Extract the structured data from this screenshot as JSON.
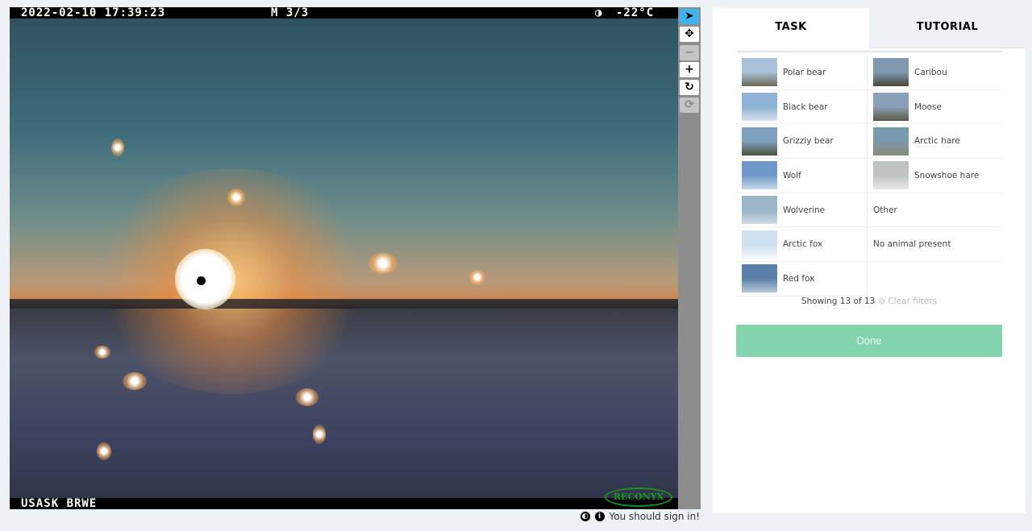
{
  "photo": {
    "timestamp": "2022-02-10 17:39:23",
    "frame": "M 3/3",
    "temperature": "-22°C",
    "moon_icon": "half-moon-icon",
    "camera_id": "USASK BRWE",
    "brand_logo": "RECONYX"
  },
  "toolbar": [
    {
      "name": "pointer",
      "glyph": "➤",
      "state": "active"
    },
    {
      "name": "move",
      "glyph": "✥",
      "state": "normal"
    },
    {
      "name": "zoom-out",
      "glyph": "−",
      "state": "disabled"
    },
    {
      "name": "zoom-in",
      "glyph": "+",
      "state": "normal"
    },
    {
      "name": "rotate",
      "glyph": "↻",
      "state": "normal"
    },
    {
      "name": "reset",
      "glyph": "⟳",
      "state": "disabled"
    }
  ],
  "footer": {
    "sign_in": "You should sign in!"
  },
  "panel": {
    "tabs": [
      {
        "label": "TASK",
        "active": true
      },
      {
        "label": "TUTORIAL",
        "active": false
      }
    ],
    "left_choices": [
      {
        "label": "Polar bear",
        "thumb": [
          "#a8c0d8",
          "#6e6a58"
        ]
      },
      {
        "label": "Black bear",
        "thumb": [
          "#8fb3d6",
          "#d6e0ea"
        ]
      },
      {
        "label": "Grizzly bear",
        "thumb": [
          "#7f9fbf",
          "#4a5238"
        ]
      },
      {
        "label": "Wolf",
        "thumb": [
          "#6f98c8",
          "#c8d8e8"
        ]
      },
      {
        "label": "Wolverine",
        "thumb": [
          "#9ab4c8",
          "#d0dae2"
        ]
      },
      {
        "label": "Arctic fox",
        "thumb": [
          "#cfe0f0",
          "#f4f8fc"
        ]
      },
      {
        "label": "Red fox",
        "thumb": [
          "#5a7fa8",
          "#b8c8d8"
        ]
      }
    ],
    "right_choices": [
      {
        "label": "Caribou",
        "thumb": [
          "#8098b0",
          "#4a4a38"
        ]
      },
      {
        "label": "Moose",
        "thumb": [
          "#8aa0b8",
          "#585a44"
        ]
      },
      {
        "label": "Arctic hare",
        "thumb": [
          "#7a9ab0",
          "#8a8a78"
        ]
      },
      {
        "label": "Snowshoe hare",
        "thumb": [
          "#c0c4c0",
          "#e8e8e4"
        ]
      },
      {
        "label": "Other"
      },
      {
        "label": "No animal present"
      }
    ],
    "status": "Showing 13 of 13",
    "clear_filters": "⊘ Clear filters",
    "done": "Done"
  },
  "colors": {
    "accent": "#3fb4f0",
    "done": "#83d3ae"
  }
}
